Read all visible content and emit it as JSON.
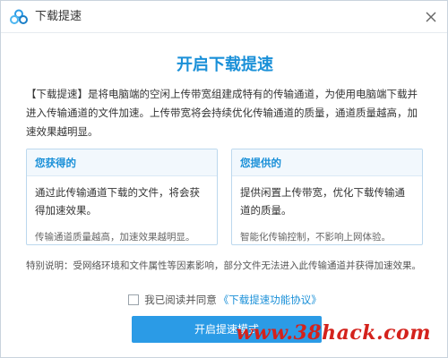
{
  "window": {
    "title": "下载提速",
    "app_icon": "cloud-icon",
    "close_icon": "close-icon"
  },
  "main": {
    "headline": "开启下载提速",
    "description": "【下载提速】是将电脑端的空闲上传带宽组建成特有的传输通道，为使用电脑端下载并进入传输通道的文件加速。上传带宽将会持续优化传输通道的质量，通道质量越高，加速效果越明显。"
  },
  "cards": {
    "gain": {
      "title": "您获得的",
      "body": "通过此传输通道下载的文件，将会获得加速效果。",
      "footnote": "传输通道质量越高，加速效果越明显。"
    },
    "provide": {
      "title": "您提供的",
      "body": "提供闲置上传带宽，优化下载传输通道的质量。",
      "footnote": "智能化传输控制，不影响上网体验。"
    }
  },
  "notice": "特别说明：受网络环境和文件属性等因素影响，部分文件无法进入此传输通道并获得加速效果。",
  "agreement": {
    "checked": false,
    "label": "我已阅读并同意",
    "link_text": "《下载提速功能协议》"
  },
  "actions": {
    "enable_label": "开启提速模式"
  },
  "watermark": "www.38hack.com",
  "colors": {
    "accent": "#1a90d8",
    "button": "#2b9be6",
    "watermark": "#d4221c"
  }
}
